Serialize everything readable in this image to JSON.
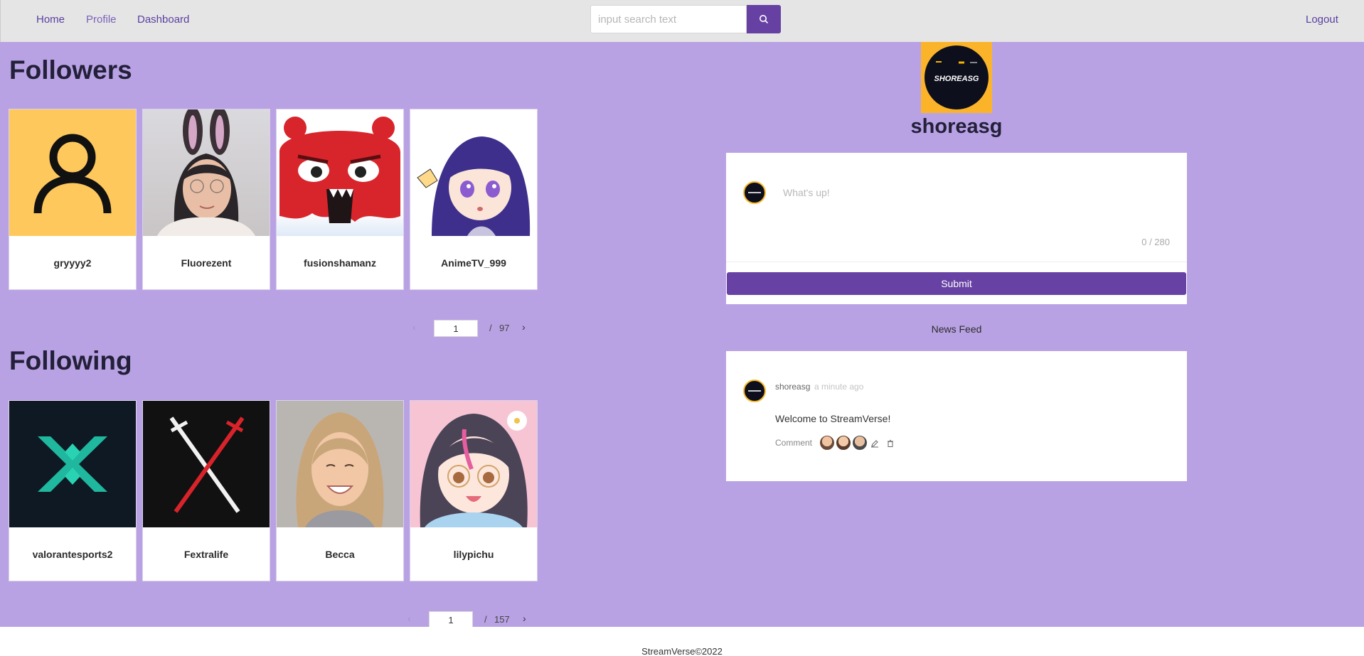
{
  "nav": {
    "links": [
      "Home",
      "Profile",
      "Dashboard"
    ],
    "logout": "Logout"
  },
  "search": {
    "placeholder": "input search text",
    "value": ""
  },
  "followers": {
    "title": "Followers",
    "cards": [
      {
        "name": "gryyyy2",
        "image": "default-avatar-icon"
      },
      {
        "name": "Fluorezent",
        "image": "user-photo"
      },
      {
        "name": "fusionshamanz",
        "image": "red-monster-avatar"
      },
      {
        "name": "AnimeTV_999",
        "image": "anime-girl-avatar"
      }
    ],
    "pager": {
      "current": "1",
      "slash": "/",
      "total": "97"
    }
  },
  "following": {
    "title": "Following",
    "cards": [
      {
        "name": "valorantesports2",
        "image": "valorant-logo"
      },
      {
        "name": "Fextralife",
        "image": "crossed-swords-logo"
      },
      {
        "name": "Becca",
        "image": "user-photo"
      },
      {
        "name": "lilypichu",
        "image": "anime-girl-avatar"
      }
    ],
    "pager": {
      "current": "1",
      "slash": "/",
      "total": "157"
    }
  },
  "profile": {
    "username": "shoreasg",
    "logo_text": "SHOREASG"
  },
  "compose": {
    "placeholder": "What's up!",
    "counter": "0 / 280",
    "submit": "Submit"
  },
  "feed": {
    "title": "News Feed",
    "posts": [
      {
        "author": "shoreasg",
        "time": "a minute ago",
        "text": "Welcome to StreamVerse!",
        "comment_label": "Comment"
      }
    ]
  },
  "footer": {
    "text": "StreamVerse©2022"
  },
  "colors": {
    "page_bg": "#b9a2e4",
    "accent": "#6740a3",
    "nav_bg": "#e5e5e5",
    "logo_bg": "#fbb42a"
  }
}
